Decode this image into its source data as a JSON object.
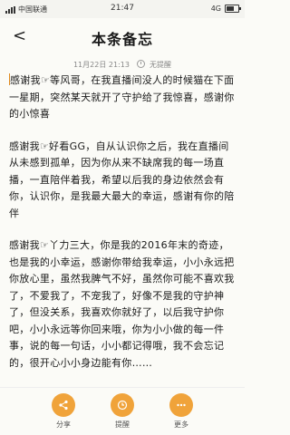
{
  "status_bar": {
    "carrier": "中国联通",
    "time": "21:47",
    "network": "4G"
  },
  "header": {
    "back_label": "<",
    "title": "本条备忘"
  },
  "meta": {
    "date": "11月22日 21:13",
    "reminder": "无提醒"
  },
  "content": {
    "paragraphs": [
      "感谢我☞等风哥，在我直播间没人的时候猫在下面一星期，突然某天就开了守护给了我惊喜，感谢你的小惊喜",
      "感谢我☞好看GG，自从认识你之后，我在直播间从未感到孤单，因为你从来不缺席我的每一场直播，一直陪伴着我，希望以后我的身边依然会有你，认识你，是我最大最大的幸运，感谢有你的陪伴",
      "感谢我☞丫力三大，你是我的2016年末的奇迹，也是我的小幸运，感谢你带给我幸运，小小永远把你放心里，虽然我脾气不好，虽然你可能不喜欢我了，不爱我了，不宠我了，好像不是我的守护神了，但没关系，我喜欢你就好了，以后我守护你吧，小小永远等你回来哦，你为小小做的每一件事，说的每一句话，小小都记得哦，我不会忘记的，很开心小小身边能有你……"
    ]
  },
  "actions": {
    "share": "分享",
    "remind": "提醒",
    "more": "更多"
  },
  "colors": {
    "accent": "#f0a33a",
    "background": "#fbfbf7"
  }
}
